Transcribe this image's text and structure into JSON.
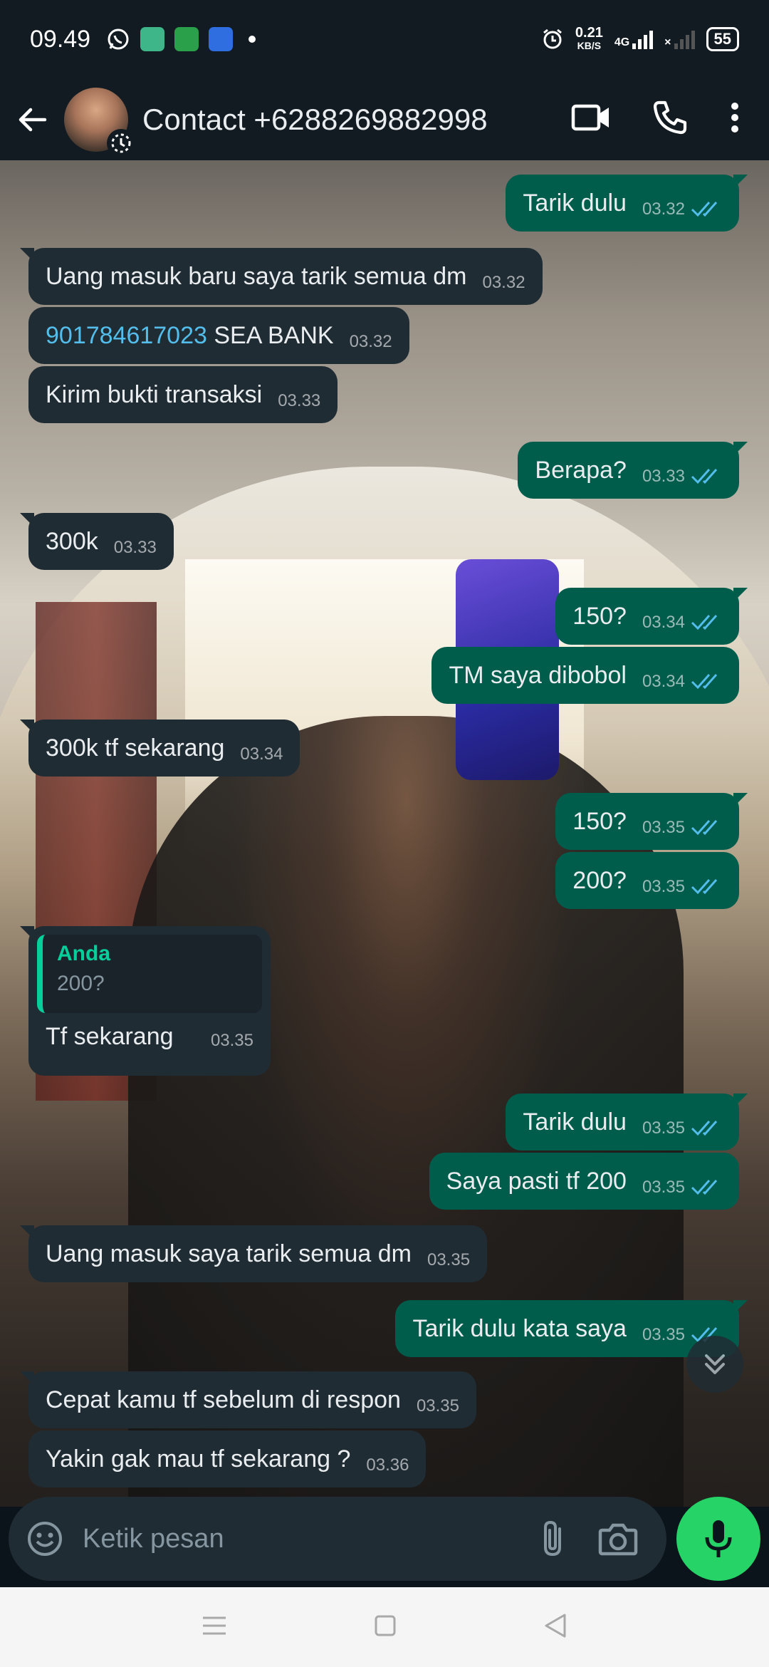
{
  "status_bar": {
    "time": "09.49",
    "net_speed_value": "0.21",
    "net_speed_unit": "KB/S",
    "network_type": "4G",
    "battery": "55",
    "icons": [
      "whatsapp-icon",
      "app-icon-green",
      "app-icon-cart",
      "app-icon-blue",
      "alarm-icon"
    ]
  },
  "header": {
    "contact_name": "Contact +6288269882998",
    "icons": [
      "back-arrow-icon",
      "video-call-icon",
      "phone-call-icon",
      "more-vert-icon"
    ]
  },
  "messages": [
    {
      "dir": "out",
      "text": "Tarik dulu",
      "time": "03.32"
    },
    {
      "dir": "in",
      "text": "Uang masuk baru saya tarik semua dm",
      "time": "03.32"
    },
    {
      "dir": "in",
      "link": "901784617023",
      "text": " SEA BANK",
      "time": "03.32"
    },
    {
      "dir": "in",
      "text": "Kirim bukti transaksi",
      "time": "03.33"
    },
    {
      "dir": "out",
      "text": "Berapa?",
      "time": "03.33"
    },
    {
      "dir": "in",
      "text": "300k",
      "time": "03.33"
    },
    {
      "dir": "out",
      "text": "150?",
      "time": "03.34"
    },
    {
      "dir": "out",
      "text": "TM saya dibobol",
      "time": "03.34"
    },
    {
      "dir": "in",
      "text": "300k tf sekarang",
      "time": "03.34"
    },
    {
      "dir": "out",
      "text": "150?",
      "time": "03.35"
    },
    {
      "dir": "out",
      "text": "200?",
      "time": "03.35"
    },
    {
      "dir": "in",
      "quote_author": "Anda",
      "quote_text": "200?",
      "text": "Tf sekarang",
      "time": "03.35"
    },
    {
      "dir": "out",
      "text": "Tarik dulu",
      "time": "03.35"
    },
    {
      "dir": "out",
      "text": "Saya pasti tf 200",
      "time": "03.35"
    },
    {
      "dir": "in",
      "text": "Uang masuk saya tarik semua dm",
      "time": "03.35"
    },
    {
      "dir": "out",
      "text": "Tarik dulu kata saya",
      "time": "03.35"
    },
    {
      "dir": "in",
      "text": "Cepat kamu tf sebelum di respon",
      "time": "03.35"
    },
    {
      "dir": "in",
      "text": "Yakin gak mau tf sekarang ?",
      "time": "03.36"
    }
  ],
  "input": {
    "placeholder": "Ketik pesan",
    "value": ""
  },
  "colors": {
    "incoming_bubble": "#202c33",
    "outgoing_bubble": "#005c4b",
    "read_ticks": "#53bdeb",
    "mic_button": "#25d366",
    "quote_author": "#06cf9c"
  }
}
